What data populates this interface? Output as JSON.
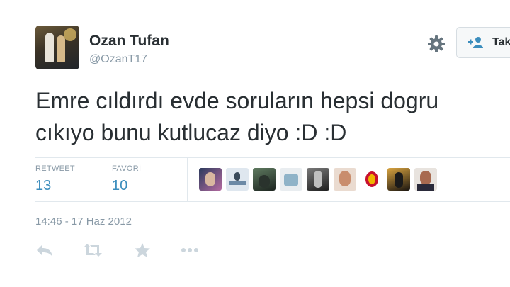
{
  "author": {
    "name": "Ozan Tufan",
    "handle": "@OzanT17"
  },
  "follow_button": {
    "label": "Tak"
  },
  "tweet": {
    "line1": "Emre cıldırdı evde soruların hepsi dogru",
    "line2": "cıkıyo bunu kutlucaz diyo :D :D"
  },
  "stats": {
    "retweet_label": "RETWEET",
    "retweet_count": "13",
    "favori_label": "FAVORİ",
    "favori_count": "10"
  },
  "favoriters": [
    {
      "name": "user-1",
      "color": "#4a5a7a"
    },
    {
      "name": "user-2",
      "color": "#c9d6e3"
    },
    {
      "name": "user-3",
      "color": "#2f3b33"
    },
    {
      "name": "user-4",
      "color": "#d8dde2"
    },
    {
      "name": "user-5",
      "color": "#3a3a3a"
    },
    {
      "name": "user-6",
      "color": "#d9a58a"
    },
    {
      "name": "galatasaray-logo",
      "color": "#f0b400"
    },
    {
      "name": "user-8",
      "color": "#3a2f1e"
    },
    {
      "name": "user-9",
      "color": "#8a6a55"
    }
  ],
  "timestamp": "14:46 - 17 Haz 2012",
  "actions": [
    "reply-icon",
    "retweet-icon",
    "favorite-icon",
    "more-icon"
  ],
  "colors": {
    "link": "#3b8dbd",
    "muted": "#8899a6",
    "action_icon": "#ccd6dd"
  }
}
